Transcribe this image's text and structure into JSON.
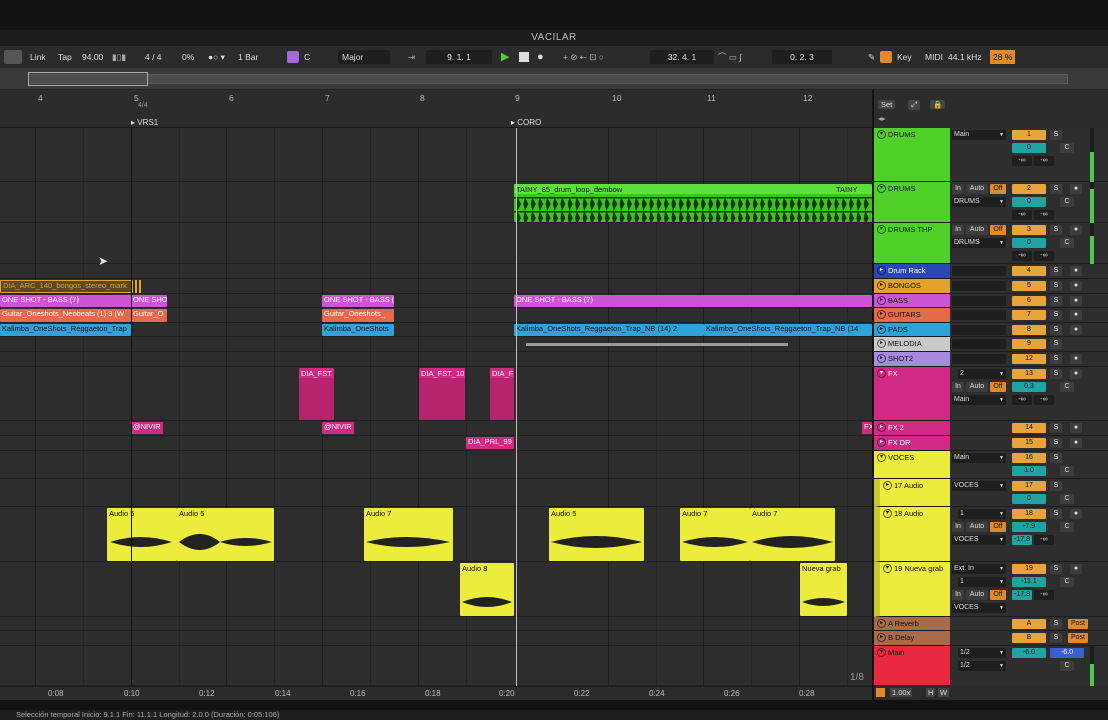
{
  "window": {
    "title": "VACILAR"
  },
  "transport": {
    "link": "Link",
    "tap": "Tap",
    "tempo": "94.00",
    "sig": "4 / 4",
    "swing": "0%",
    "quant": "1 Bar",
    "key": "C",
    "scale": "Major",
    "position": "9.  1.  1",
    "loop_start": "32.  4.  1",
    "loop_len": "0.  2.  3",
    "key_btn": "Key",
    "midi": "MIDI",
    "sample_rate": "44.1 kHz",
    "cpu": "28 %"
  },
  "ruler": {
    "bars": [
      "4",
      "5",
      "6",
      "7",
      "8",
      "9",
      "10",
      "11",
      "12"
    ],
    "locators": [
      "VRS1",
      "CORO"
    ],
    "sig": "4/4"
  },
  "timeline": {
    "labels": [
      "0:08",
      "0:10",
      "0:12",
      "0:14",
      "0:16",
      "0:18",
      "0:20",
      "0:22",
      "0:24",
      "0:26",
      "0:28"
    ],
    "page": "1/8"
  },
  "clips": {
    "drum_loop": "TAINY_85_drum_loop_dembow",
    "drum_loop2": "TAINY",
    "bongos": "DIA_ARC_140_bongos_stereo_mark",
    "bass1": "ONE SHOT - BASS  (7)",
    "bass2": "ONE SHO",
    "bass3": "ONE SHOT - BASS  (",
    "bass4": "ONE SHOT - BASS  (7)",
    "guitar1": "Guitar_Oneshots_Neobeats (1) 3 (W",
    "guitar2": "Guitar_O",
    "guitar3": "Guitar_Oneshots_",
    "pads1": "Kalimba_OneShots_Reggaeton_Trap",
    "pads2": "Kalimba_OneShots",
    "pads3": "Kalimba_OneShots_Reggaeton_Trap_NB (14) 2",
    "pads4": "Kalimba_OneShots_Reggaeton_Trap_NB (14",
    "fx1": "DIA_FST",
    "fx2": "DIA_FST_10",
    "fx3": "DIA_F",
    "fx2a": "@NIVIR",
    "fx2b": "@NIVIR",
    "fx2c": "FX",
    "fxdr": "DIA_PRL_99",
    "a5a": "Audio 5",
    "a5b": "Audio 5",
    "a7a": "Audio 7",
    "a5c": "Audio 5",
    "a7b": "Audio 7",
    "a7c": "Audio 7",
    "a8": "Audio 8",
    "nueva": "Nueva grab"
  },
  "tracks": [
    {
      "name": "DRUMS",
      "num": "1",
      "color": "#4fd12a"
    },
    {
      "name": "DRUMS",
      "num": "2",
      "color": "#4fd12a"
    },
    {
      "name": "DRUMS THP",
      "num": "3",
      "color": "#4fd12a"
    },
    {
      "name": "Drum Rack",
      "num": "4",
      "color": "#2a46b8"
    },
    {
      "name": "BONGOS",
      "num": "5",
      "color": "#e3a12f"
    },
    {
      "name": "BASS",
      "num": "6",
      "color": "#cc55d6"
    },
    {
      "name": "GUITARS",
      "num": "7",
      "color": "#e66a4a"
    },
    {
      "name": "PADS",
      "num": "8",
      "color": "#2ea3d9"
    },
    {
      "name": "MELODIA",
      "num": "9",
      "color": "#c9c9c9"
    },
    {
      "name": "SHOT2",
      "num": "12",
      "color": "#a68ae0"
    },
    {
      "name": "FX",
      "num": "13",
      "color": "#d12a82"
    },
    {
      "name": "FX 2",
      "num": "14",
      "color": "#d12a82"
    },
    {
      "name": "FX DR",
      "num": "15",
      "color": "#d12a82"
    },
    {
      "name": "VOCES",
      "num": "16",
      "color": "#ecec3c"
    },
    {
      "name": "17 Audio",
      "num": "17",
      "color": "#ecec3c"
    },
    {
      "name": "18 Audio",
      "num": "18",
      "color": "#ecec3c"
    },
    {
      "name": "19 Nueva grab",
      "num": "19",
      "color": "#ecec3c"
    },
    {
      "name": "A Reverb",
      "num": "A",
      "color": "#a86b4a"
    },
    {
      "name": "B Delay",
      "num": "B",
      "color": "#a86b4a"
    },
    {
      "name": "Main",
      "num": "",
      "color": "#e8283f"
    }
  ],
  "mixer": {
    "main": "Main",
    "in": "In",
    "auto": "Auto",
    "off": "Off",
    "drums_route": "DRUMS",
    "voces_route": "VOCES",
    "ext_in": "Ext. In",
    "one": "1",
    "two": "2",
    "half": "1/2",
    "post": "Post",
    "s": "S",
    "c": "C",
    "vol0": "0",
    "vol03": "0.3",
    "vol10": "1.0",
    "neginf": "-∞",
    "v79": "-7.9",
    "v178": "-17.8",
    "v111": "-11.1",
    "v60": "-6.0",
    "v60b": "-6.0",
    "set": "Set",
    "zoom": "1.00x",
    "h": "H",
    "w": "W"
  },
  "status": {
    "text": "Selección temporal   Inicio: 9.1.1   Fin: 11.1.1   Longitud: 2.0.0  (Duración: 0:05:106)"
  }
}
